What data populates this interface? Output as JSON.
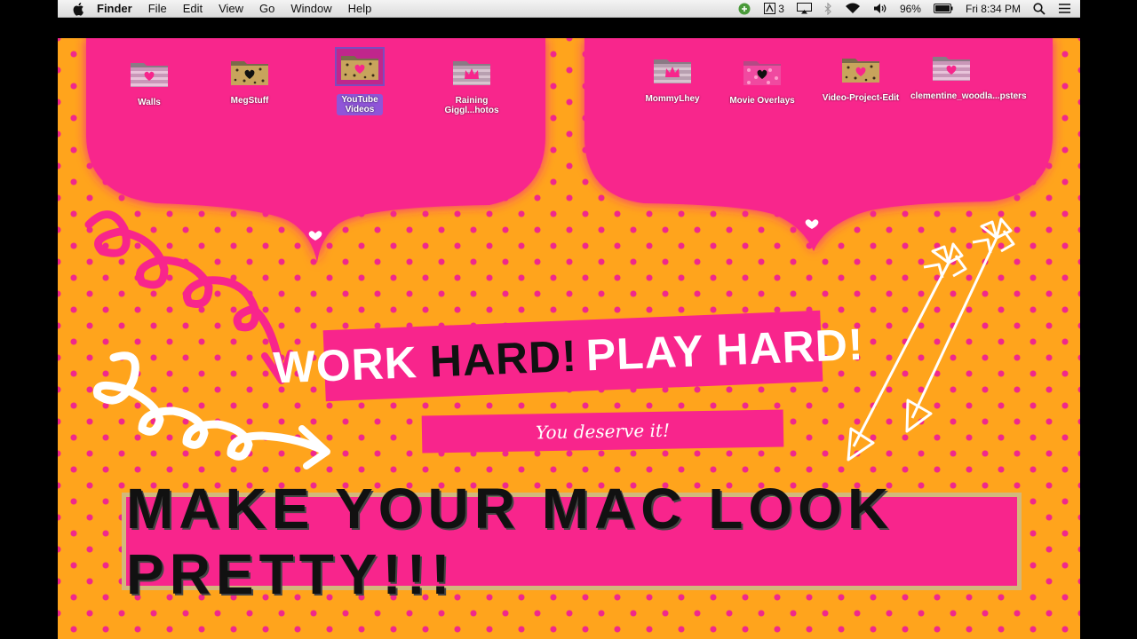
{
  "menubar": {
    "app_name": "Finder",
    "items": [
      "File",
      "Edit",
      "View",
      "Go",
      "Window",
      "Help"
    ],
    "status": {
      "adobe_count": "3",
      "battery": "96%",
      "clock": "Fri 8:34 PM"
    }
  },
  "desktop": {
    "icons": [
      {
        "label": "Walls",
        "style": "pink-heart"
      },
      {
        "label": "MegStuff",
        "style": "leopard-heart"
      },
      {
        "label": "YouTube Videos",
        "style": "leopard-heart",
        "selected": true
      },
      {
        "label": "Raining Giggl...hotos",
        "style": "crown"
      },
      {
        "label": "MommyLhey",
        "style": "crown"
      },
      {
        "label": "Movie Overlays",
        "style": "pink-dots"
      },
      {
        "label": "Video-Project-Edit",
        "style": "leopard-heart"
      },
      {
        "label": "clementine_woodla...psters",
        "style": "pink-heart"
      }
    ],
    "headline": {
      "word1": "WORK",
      "word2": "HARD!",
      "word3": "PLAY",
      "word4": "HARD!"
    },
    "tagline": "You deserve it!",
    "title": "MAKE YOUR MAC LOOK PRETTY!!!"
  },
  "colors": {
    "background": "#ffa41c",
    "pink": "#f8258c",
    "dot": "#f0288c",
    "selection": "#8f55d8"
  }
}
